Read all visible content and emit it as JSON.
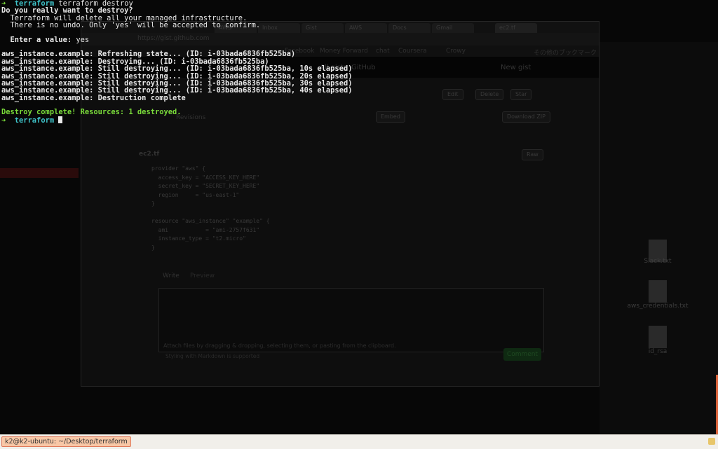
{
  "terminal": {
    "lines": [
      {
        "kind": "prompt",
        "arrow": "➜",
        "dir": "terraform",
        "cmd": "terraform destroy"
      },
      {
        "kind": "bold",
        "text": "Do you really want to destroy?"
      },
      {
        "kind": "plain",
        "text": "  Terraform will delete all your managed infrastructure."
      },
      {
        "kind": "plain",
        "text": "  There is no undo. Only 'yes' will be accepted to confirm."
      },
      {
        "kind": "blank",
        "text": ""
      },
      {
        "kind": "input",
        "label": "  Enter a value:",
        "value": " yes"
      },
      {
        "kind": "blank",
        "text": ""
      },
      {
        "kind": "bold",
        "text": "aws_instance.example: Refreshing state... (ID: i-03bada6836fb525ba)"
      },
      {
        "kind": "bold",
        "text": "aws_instance.example: Destroying... (ID: i-03bada6836fb525ba)"
      },
      {
        "kind": "bold",
        "text": "aws_instance.example: Still destroying... (ID: i-03bada6836fb525ba, 10s elapsed)"
      },
      {
        "kind": "bold",
        "text": "aws_instance.example: Still destroying... (ID: i-03bada6836fb525ba, 20s elapsed)"
      },
      {
        "kind": "bold",
        "text": "aws_instance.example: Still destroying... (ID: i-03bada6836fb525ba, 30s elapsed)"
      },
      {
        "kind": "bold",
        "text": "aws_instance.example: Still destroying... (ID: i-03bada6836fb525ba, 40s elapsed)"
      },
      {
        "kind": "bold",
        "text": "aws_instance.example: Destruction complete"
      },
      {
        "kind": "blank",
        "text": ""
      },
      {
        "kind": "green",
        "text": "Destroy complete! Resources: 1 destroyed."
      },
      {
        "kind": "prompt-cursor",
        "arrow": "➜",
        "dir": "terraform"
      }
    ]
  },
  "browser": {
    "url": "https://gist.github.com",
    "tabs": [
      "AWS",
      "Inbox",
      "Gist",
      "AWS",
      "Docs",
      "Gmail",
      "ec2.tf"
    ],
    "bookmarks": [
      "Facebook",
      "Money Forward",
      "chat",
      "Coursera",
      "Crowy"
    ],
    "bookmarks_right": "その他のブックマーク",
    "header_links": [
      "All gists",
      "GitHub"
    ],
    "header_right": "New gist",
    "actions": [
      "Edit",
      "Delete",
      "Star"
    ],
    "revisions": "Revisions",
    "embed": "Embed",
    "download": "Download ZIP",
    "filename": "ec2.tf",
    "raw": "Raw",
    "code": "provider \"aws\" {\n  access_key = \"ACCESS_KEY_HERE\"\n  secret_key = \"SECRET_KEY_HERE\"\n  region     = \"us-east-1\"\n}\n\nresource \"aws_instance\" \"example\" {\n  ami           = \"ami-2757f631\"\n  instance_type = \"t2.micro\"\n}",
    "write_tab": "Write",
    "preview_tab": "Preview",
    "attach_hint": "Attach files by dragging & dropping, selecting them, or pasting from the clipboard.",
    "markdown_hint": "Styling with Markdown is supported",
    "comment_button": "Comment"
  },
  "desktop": {
    "files": [
      "Slack.txt",
      "aws_credentials.txt",
      "id_rsa"
    ]
  },
  "taskbar": {
    "active_window": "k2@k2-ubuntu: ~/Desktop/terraform"
  },
  "colors": {
    "prompt_arrow": "#7adb3a",
    "prompt_dir": "#3ec2c8",
    "success": "#7adb3a",
    "taskbar_active": "#f8c7a6"
  }
}
